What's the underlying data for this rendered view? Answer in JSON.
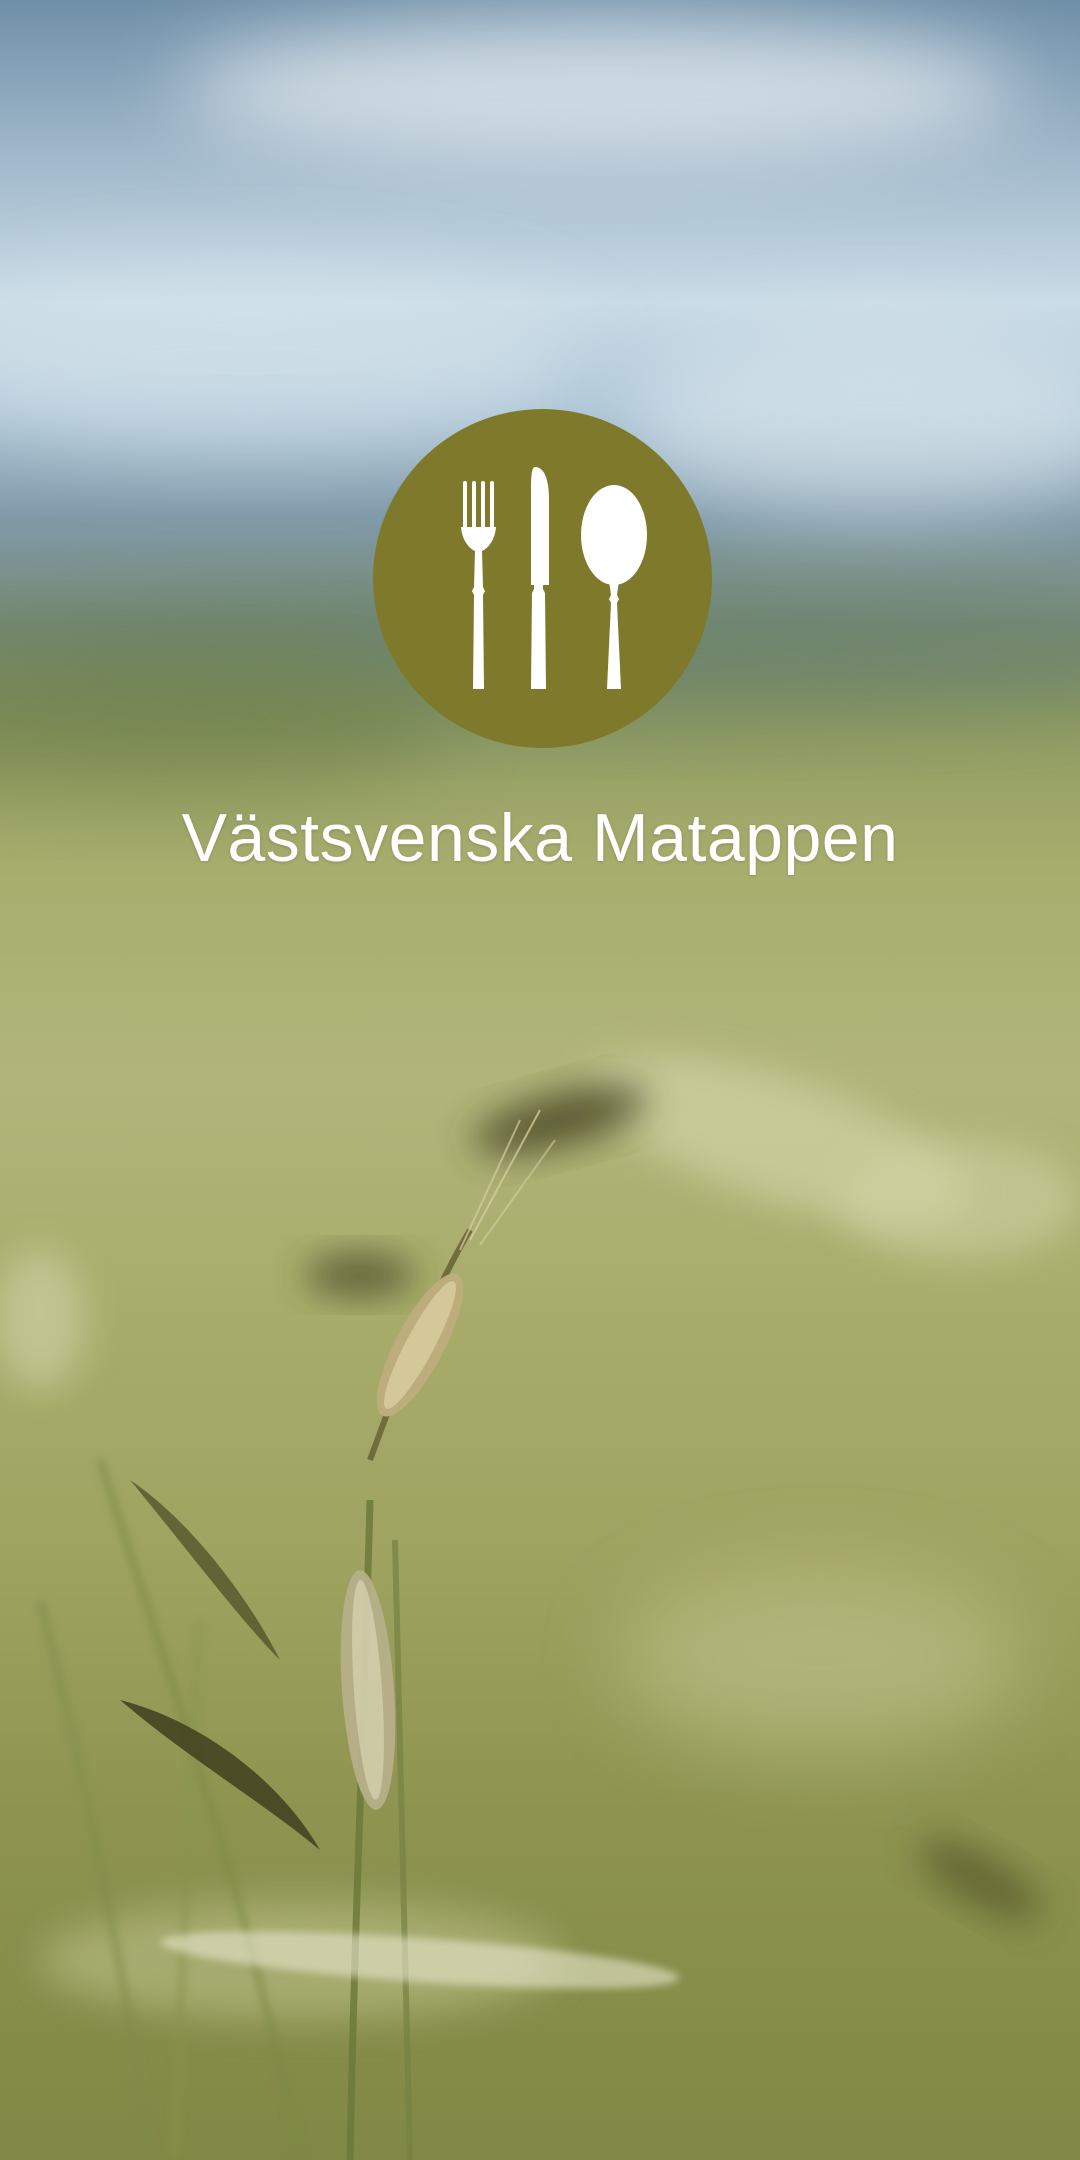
{
  "app": {
    "title": "Västsvenska Matappen"
  },
  "logo": {
    "icon": "cutlery-icon",
    "background_color": "#7f7a2b",
    "icon_color": "#ffffff"
  },
  "background": {
    "description_icon": "wheat-field-background"
  }
}
